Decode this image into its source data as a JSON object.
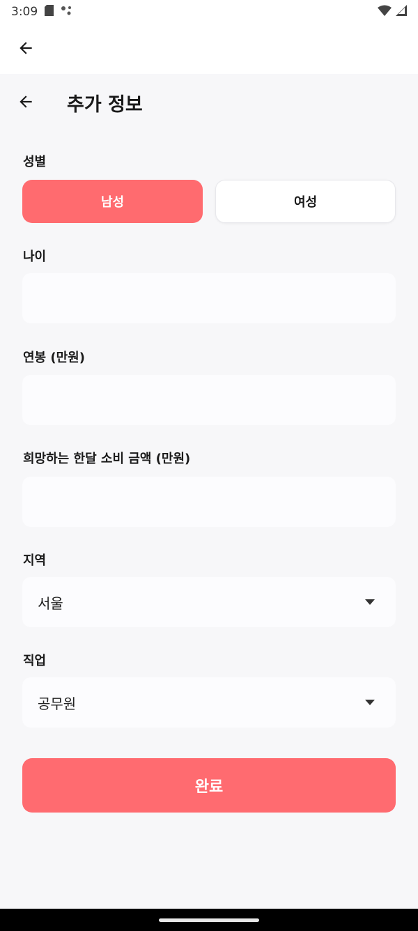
{
  "status_bar": {
    "time": "3:09",
    "icons": [
      "sd-card-icon",
      "assistant-dots-icon",
      "wifi-icon",
      "cell-signal-icon"
    ]
  },
  "header": {
    "title": "추가 정보"
  },
  "gender": {
    "label": "성별",
    "options": [
      "남성",
      "여성"
    ],
    "selected": "남성"
  },
  "age": {
    "label": "나이",
    "value": "",
    "placeholder": ""
  },
  "salary": {
    "label": "연봉 (만원)",
    "value": "",
    "placeholder": ""
  },
  "spending": {
    "label": "희망하는 한달 소비 금액 (만원)",
    "value": "",
    "placeholder": ""
  },
  "region": {
    "label": "지역",
    "selected": "서울"
  },
  "job": {
    "label": "직업",
    "selected": "공무원"
  },
  "submit": {
    "label": "완료"
  },
  "colors": {
    "accent": "#ff6b6f",
    "background": "#f7f7f9",
    "field": "#fcfcfe"
  }
}
